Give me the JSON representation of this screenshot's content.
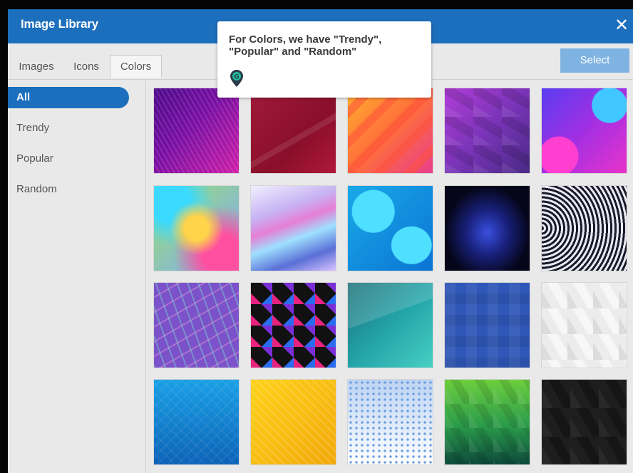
{
  "dialog": {
    "title": "Image Library",
    "close_symbol": "✕"
  },
  "tabs": [
    {
      "label": "Images",
      "active": false
    },
    {
      "label": "Icons",
      "active": false
    },
    {
      "label": "Colors",
      "active": true
    }
  ],
  "select_button": {
    "label": "Select"
  },
  "sidebar": {
    "items": [
      {
        "label": "All",
        "active": true
      },
      {
        "label": "Trendy",
        "active": false
      },
      {
        "label": "Popular",
        "active": false
      },
      {
        "label": "Random",
        "active": false
      }
    ]
  },
  "tooltip": {
    "text": "For Colors, we have \"Trendy\", \"Popular\" and \"Random\"",
    "pin_icon": "location-pin-icon"
  },
  "colors": {
    "accent": "#1c6fbd",
    "select_button": "#7fb3e2",
    "panel_bg": "#e9e9e9"
  },
  "grid": {
    "rows": 4,
    "columns": 5,
    "tiles": [
      {
        "name": "purple-waves"
      },
      {
        "name": "crimson-abstract"
      },
      {
        "name": "orange-stripes"
      },
      {
        "name": "purple-lowpoly"
      },
      {
        "name": "blue-pink-blobs"
      },
      {
        "name": "holographic-rainbow"
      },
      {
        "name": "iridescent-wave"
      },
      {
        "name": "cyan-shapes"
      },
      {
        "name": "starry-galaxy"
      },
      {
        "name": "black-white-curves"
      },
      {
        "name": "purple-sprinkles"
      },
      {
        "name": "geometric-triangles"
      },
      {
        "name": "teal-gradient"
      },
      {
        "name": "blue-squares"
      },
      {
        "name": "white-lowpoly"
      },
      {
        "name": "blue-texture"
      },
      {
        "name": "yellow-dots"
      },
      {
        "name": "blue-halftone"
      },
      {
        "name": "green-lowpoly"
      },
      {
        "name": "black-lowpoly"
      }
    ]
  }
}
